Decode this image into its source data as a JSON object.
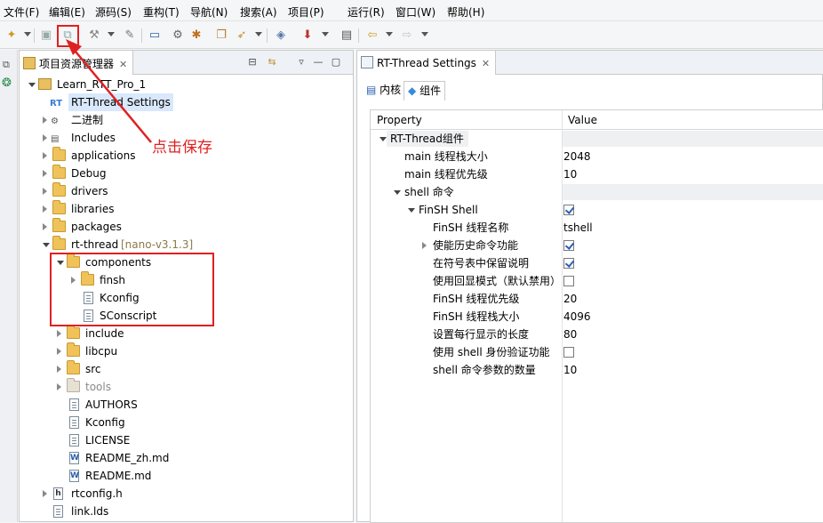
{
  "menubar": {
    "items": [
      "文件(F)",
      "编辑(E)",
      "源码(S)",
      "重构(T)",
      "导航(N)",
      "搜索(A)",
      "项目(P)",
      "运行(R)",
      "窗口(W)",
      "帮助(H)"
    ]
  },
  "toolbar": {
    "icons": [
      "new-icon",
      "save-icon",
      "save-all-icon",
      "build-icon",
      "tools-icon",
      "console-icon",
      "debug-icon",
      "bug-icon",
      "open-icon",
      "run-icon",
      "config-icon",
      "download-icon",
      "layout-icon",
      "back-icon",
      "forward-icon"
    ]
  },
  "explorer": {
    "tab_label": "项目资源管理器",
    "tree": [
      {
        "label": "Learn_RTT_Pro_1",
        "decor": ""
      },
      {
        "label": "RT-Thread Settings",
        "decor": ""
      },
      {
        "label": "二进制",
        "decor": ""
      },
      {
        "label": "Includes",
        "decor": ""
      },
      {
        "label": "applications",
        "decor": ""
      },
      {
        "label": "Debug",
        "decor": ""
      },
      {
        "label": "drivers",
        "decor": ""
      },
      {
        "label": "libraries",
        "decor": ""
      },
      {
        "label": "packages",
        "decor": ""
      },
      {
        "label": "rt-thread",
        "decor": "[nano-v3.1.3]"
      },
      {
        "label": "components",
        "decor": ""
      },
      {
        "label": "finsh",
        "decor": ""
      },
      {
        "label": "Kconfig",
        "decor": ""
      },
      {
        "label": "SConscript",
        "decor": ""
      },
      {
        "label": "include",
        "decor": ""
      },
      {
        "label": "libcpu",
        "decor": ""
      },
      {
        "label": "src",
        "decor": ""
      },
      {
        "label": "tools",
        "decor": ""
      },
      {
        "label": "AUTHORS",
        "decor": ""
      },
      {
        "label": "Kconfig",
        "decor": ""
      },
      {
        "label": "LICENSE",
        "decor": ""
      },
      {
        "label": "README_zh.md",
        "decor": ""
      },
      {
        "label": "README.md",
        "decor": ""
      },
      {
        "label": "rtconfig.h",
        "decor": ""
      },
      {
        "label": "link.lds",
        "decor": ""
      }
    ]
  },
  "annotation": {
    "text": "点击保存",
    "color": "#e02020"
  },
  "settings": {
    "tab_label": "RT-Thread Settings",
    "subtabs": [
      "内核",
      "组件"
    ],
    "header": {
      "property": "Property",
      "value": "Value"
    },
    "rows": [
      {
        "name": "RT-Thread组件",
        "value": ""
      },
      {
        "name": "main 线程栈大小",
        "value": "2048"
      },
      {
        "name": "main 线程优先级",
        "value": "10"
      },
      {
        "name": "shell 命令",
        "value": ""
      },
      {
        "name": "FinSH Shell",
        "value": "",
        "checked": true
      },
      {
        "name": "FinSH 线程名称",
        "value": "tshell"
      },
      {
        "name": "使能历史命令功能",
        "value": "",
        "checked": true
      },
      {
        "name": "在符号表中保留说明",
        "value": "",
        "checked": true
      },
      {
        "name": "使用回显模式（默认禁用）",
        "value": "",
        "checked": false
      },
      {
        "name": "FinSH 线程优先级",
        "value": "20"
      },
      {
        "name": "FinSH 线程栈大小",
        "value": "4096"
      },
      {
        "name": "设置每行显示的长度",
        "value": "80"
      },
      {
        "name": "使用 shell 身份验证功能",
        "value": "",
        "checked": false
      },
      {
        "name": "shell 命令参数的数量",
        "value": "10"
      }
    ]
  }
}
